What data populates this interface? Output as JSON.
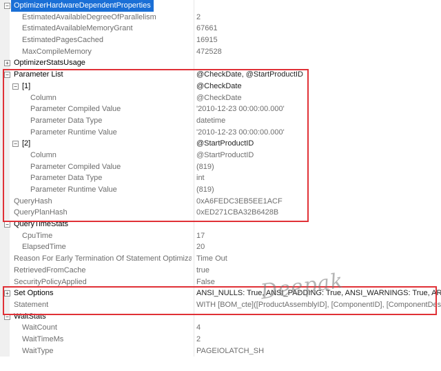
{
  "rows": [
    {
      "name": "OptimizerHardwareDependentProperties",
      "value": "",
      "level": 0,
      "expander": "minus",
      "category": true,
      "selected": true
    },
    {
      "name": "EstimatedAvailableDegreeOfParallelism",
      "value": "2",
      "level": 1
    },
    {
      "name": "EstimatedAvailableMemoryGrant",
      "value": "67661",
      "level": 1
    },
    {
      "name": "EstimatedPagesCached",
      "value": "16915",
      "level": 1
    },
    {
      "name": "MaxCompileMemory",
      "value": "472528",
      "level": 1
    },
    {
      "name": "OptimizerStatsUsage",
      "value": "",
      "level": 0,
      "expander": "plus",
      "category": true
    },
    {
      "name": "Parameter List",
      "value": "@CheckDate, @StartProductID",
      "level": 0,
      "expander": "minus",
      "category": true
    },
    {
      "name": "[1]",
      "value": "@CheckDate",
      "level": 1,
      "expander": "minus",
      "category": true
    },
    {
      "name": "Column",
      "value": "@CheckDate",
      "level": 2
    },
    {
      "name": "Parameter Compiled Value",
      "value": "'2010-12-23 00:00:00.000'",
      "level": 2
    },
    {
      "name": "Parameter Data Type",
      "value": "datetime",
      "level": 2
    },
    {
      "name": "Parameter Runtime Value",
      "value": "'2010-12-23 00:00:00.000'",
      "level": 2
    },
    {
      "name": "[2]",
      "value": "@StartProductID",
      "level": 1,
      "expander": "minus",
      "category": true
    },
    {
      "name": "Column",
      "value": "@StartProductID",
      "level": 2
    },
    {
      "name": "Parameter Compiled Value",
      "value": "(819)",
      "level": 2
    },
    {
      "name": "Parameter Data Type",
      "value": "int",
      "level": 2
    },
    {
      "name": "Parameter Runtime Value",
      "value": "(819)",
      "level": 2
    },
    {
      "name": "QueryHash",
      "value": "0xA6FEDC3EB5EE1ACF",
      "level": 0
    },
    {
      "name": "QueryPlanHash",
      "value": "0xED271CBA32B6428B",
      "level": 0
    },
    {
      "name": "QueryTimeStats",
      "value": "",
      "level": 0,
      "expander": "minus",
      "category": true
    },
    {
      "name": "CpuTime",
      "value": "17",
      "level": 1
    },
    {
      "name": "ElapsedTime",
      "value": "20",
      "level": 1
    },
    {
      "name": "Reason For Early Termination Of Statement Optimization",
      "value": "Time Out",
      "level": 0
    },
    {
      "name": "RetrievedFromCache",
      "value": "true",
      "level": 0
    },
    {
      "name": "SecurityPolicyApplied",
      "value": "False",
      "level": 0
    },
    {
      "name": "Set Options",
      "value": "ANSI_NULLS: True, ANSI_PADDING: True, ANSI_WARNINGS: True, ARITHABORT",
      "level": 0,
      "expander": "plus",
      "category": true
    },
    {
      "name": "Statement",
      "value": "WITH [BOM_cte]([ProductAssemblyID], [ComponentID], [ComponentDesc], [",
      "level": 0
    },
    {
      "name": "WaitStats",
      "value": "",
      "level": 0,
      "expander": "minus",
      "category": true
    },
    {
      "name": "WaitCount",
      "value": "4",
      "level": 1
    },
    {
      "name": "WaitTimeMs",
      "value": "2",
      "level": 1
    },
    {
      "name": "WaitType",
      "value": "PAGEIOLATCH_SH",
      "level": 1
    }
  ],
  "watermark": "Deepak",
  "colors": {
    "selection": "#1a6fd6",
    "highlight_box": "#e03036"
  }
}
